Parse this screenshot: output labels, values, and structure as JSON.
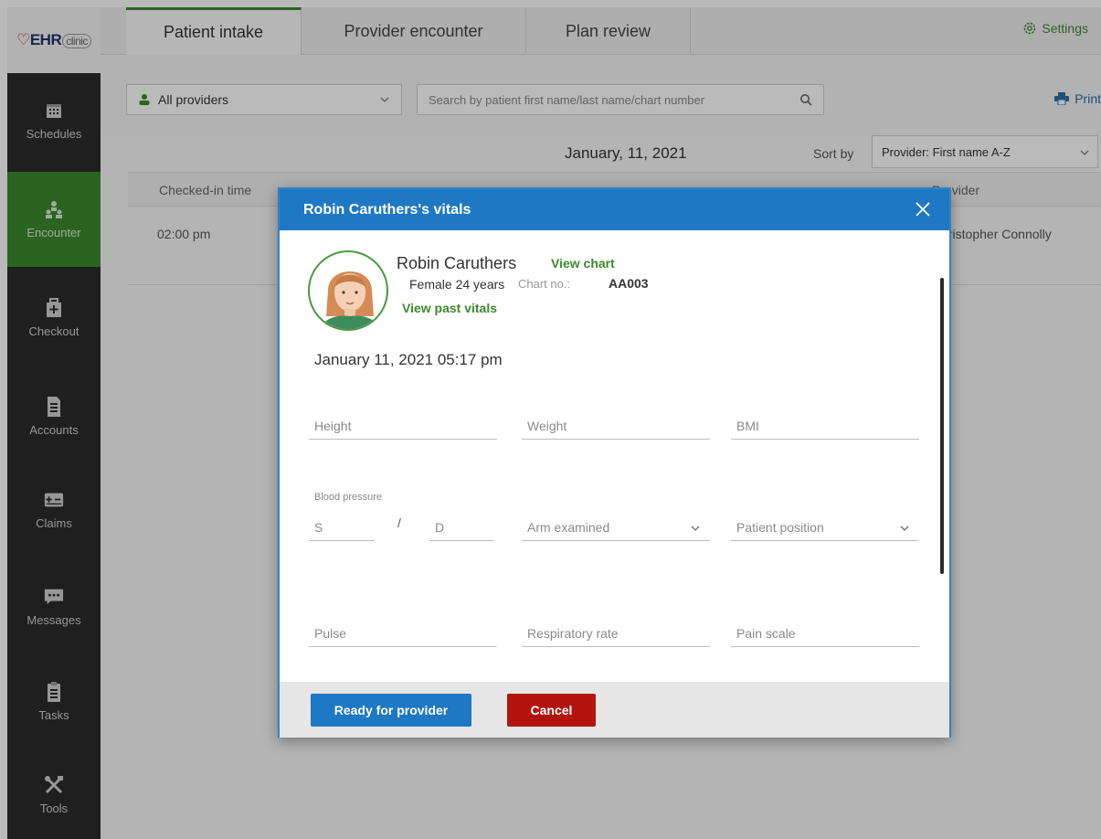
{
  "app": {
    "logo_text": "EHR",
    "logo_sub": "clinic"
  },
  "sidebar": {
    "items": [
      {
        "label": "Schedules",
        "icon": "calendar-icon",
        "active": false
      },
      {
        "label": "Encounter",
        "icon": "people-icon",
        "active": true
      },
      {
        "label": "Checkout",
        "icon": "medical-bag-icon",
        "active": false
      },
      {
        "label": "Accounts",
        "icon": "document-icon",
        "active": false
      },
      {
        "label": "Claims",
        "icon": "claims-card-icon",
        "active": false
      },
      {
        "label": "Messages",
        "icon": "message-icon",
        "active": false
      },
      {
        "label": "Tasks",
        "icon": "clipboard-icon",
        "active": false
      },
      {
        "label": "Tools",
        "icon": "tools-icon",
        "active": false
      }
    ]
  },
  "tabs": [
    {
      "label": "Patient intake",
      "active": true
    },
    {
      "label": "Provider encounter",
      "active": false
    },
    {
      "label": "Plan review",
      "active": false
    }
  ],
  "header": {
    "settings_label": "Settings"
  },
  "filters": {
    "provider_select": "All providers",
    "search_placeholder": "Search by patient first name/last name/chart number",
    "print_label": "Print",
    "date": "January, 11, 2021",
    "sort_label": "Sort by",
    "sort_value": "Provider: First name A-Z"
  },
  "table": {
    "columns": {
      "checked_in": "Checked-in time",
      "provider": "Provider"
    },
    "rows": [
      {
        "time": "02:00 pm",
        "provider": "Christopher Connolly"
      }
    ]
  },
  "modal": {
    "title": "Robin Caruthers's vitals",
    "patient": {
      "name": "Robin Caruthers",
      "view_chart": "View chart",
      "gender_age": "Female  24 years",
      "chart_label": "Chart no.:",
      "chart_no": "AA003",
      "view_past": "View past vitals"
    },
    "datetime": "January 11, 2021 05:17 pm",
    "fields": {
      "height": "Height",
      "weight": "Weight",
      "bmi": "BMI",
      "bp_label": "Blood pressure",
      "bp_s": "S",
      "bp_slash": "/",
      "bp_d": "D",
      "arm": "Arm examined",
      "position": "Patient position",
      "pulse": "Pulse",
      "resp": "Respiratory rate",
      "pain": "Pain scale"
    },
    "buttons": {
      "ready": "Ready for provider",
      "cancel": "Cancel"
    }
  },
  "colors": {
    "green": "#3c8a2e",
    "blue": "#1e78c4",
    "red": "#b3130f",
    "sidebar": "#2b2b2b"
  }
}
